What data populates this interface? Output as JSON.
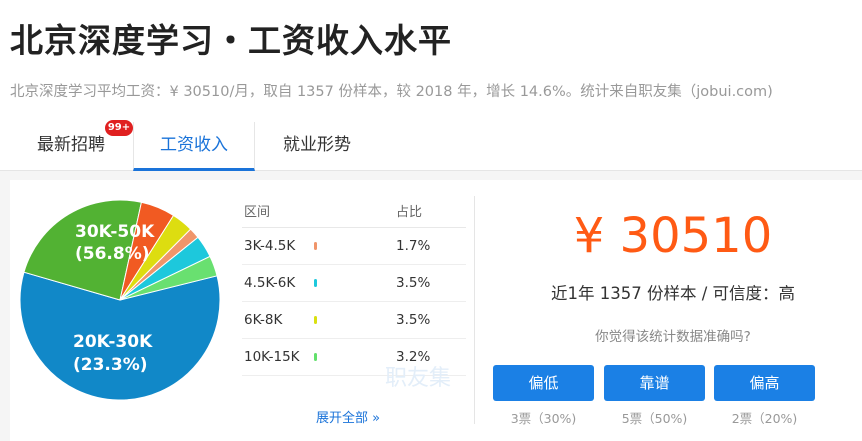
{
  "header": {
    "title": "北京深度学习・工资收入水平",
    "subtitle": "北京深度学习平均工资：¥ 30510/月，取自 1357 份样本，较 2018 年，增长 14.6%。统计来自职友集（jobui.com)"
  },
  "tabs": [
    {
      "label": "最新招聘",
      "badge": "99+"
    },
    {
      "label": "工资收入"
    },
    {
      "label": "就业形势"
    }
  ],
  "chart_data": {
    "type": "pie",
    "slices": [
      {
        "label": "30K-50K",
        "pct_label": "(56.8%)",
        "value": 56.8,
        "color": "#1188c8"
      },
      {
        "label": "20K-30K",
        "pct_label": "(23.3%)",
        "value": 23.3,
        "color": "#52b233"
      },
      {
        "label": "",
        "value": 5.4,
        "color": "#f15a22"
      },
      {
        "label": "",
        "value": 3.4,
        "color": "#dddd10"
      },
      {
        "label": "3K-4.5K",
        "value": 1.7,
        "color": "#f0956a"
      },
      {
        "label": "4.5K-6K",
        "value": 3.5,
        "color": "#1dc8dc"
      },
      {
        "label": "10K-15K",
        "value": 3.2,
        "color": "#69e070"
      }
    ]
  },
  "table": {
    "col_range": "区间",
    "col_pct": "占比",
    "rows": [
      {
        "range": "3K-4.5K",
        "pct": "1.7%",
        "color": "#f0956a"
      },
      {
        "range": "4.5K-6K",
        "pct": "3.5%",
        "color": "#1dc8dc"
      },
      {
        "range": "6K-8K",
        "pct": "3.5%",
        "color": "#d9e010"
      },
      {
        "range": "10K-15K",
        "pct": "3.2%",
        "color": "#62e06b"
      }
    ],
    "expand": "展开全部 »"
  },
  "watermark": "职友集",
  "summary": {
    "salary": "¥ 30510",
    "samples": "近1年 1357 份样本 / 可信度：高",
    "question": "你觉得该统计数据准确吗?"
  },
  "votes": [
    {
      "label": "偏低",
      "count": "3票（30%)"
    },
    {
      "label": "靠谱",
      "count": "5票（50%)"
    },
    {
      "label": "偏高",
      "count": "2票（20%)"
    }
  ]
}
